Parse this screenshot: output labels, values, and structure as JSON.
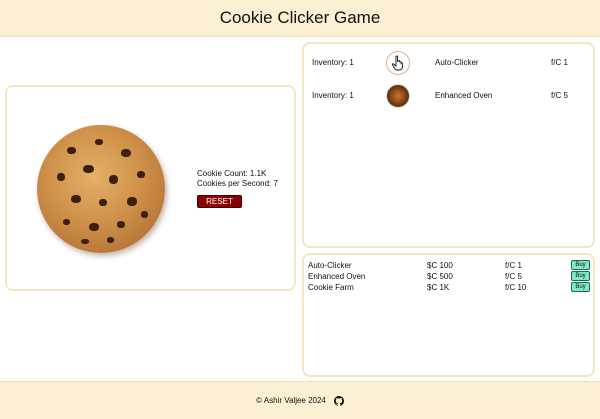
{
  "header": {
    "title": "Cookie Clicker Game"
  },
  "game": {
    "cookie_count": "Cookie Count: 1.1K",
    "cookies_per_second": "Cookies per Second: 7",
    "reset_label": "RESET"
  },
  "inventory": [
    {
      "count": "Inventory: 1",
      "icon": "pointer-hand-icon",
      "name": "Auto-Clicker",
      "rate": "f/C 1"
    },
    {
      "count": "Inventory: 1",
      "icon": "oven-icon",
      "name": "Enhanced Oven",
      "rate": "f/C 5"
    }
  ],
  "shop": [
    {
      "name": "Auto-Clicker",
      "cost": "$C 100",
      "rate": "f/C 1",
      "buy_label": "Buy"
    },
    {
      "name": "Enhanced Oven",
      "cost": "$C 500",
      "rate": "f/C 5",
      "buy_label": "Buy"
    },
    {
      "name": "Cookie Farm",
      "cost": "$C 1K",
      "rate": "f/C 10",
      "buy_label": "Buy"
    }
  ],
  "footer": {
    "text": "© Ashir Valjee 2024",
    "icon": "github-icon"
  },
  "colors": {
    "header_bg": "#fbefd4",
    "panel_border": "#f5e6bf",
    "reset_bg": "#8b0000",
    "buy_bg": "#7fe9c8"
  }
}
